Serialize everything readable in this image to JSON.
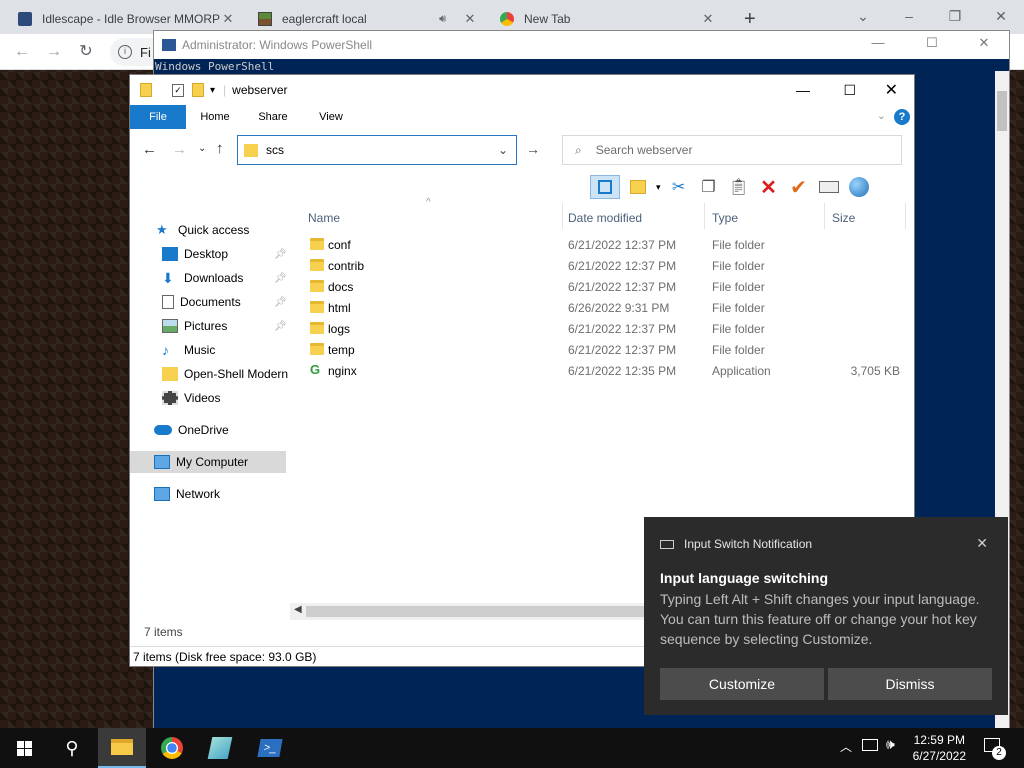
{
  "chrome": {
    "tabs": [
      {
        "title": "Idlescape - Idle Browser MMORP"
      },
      {
        "title": "eaglercraft local",
        "audio": true
      },
      {
        "title": "New Tab"
      }
    ],
    "new_tab": "+",
    "address_partial": "Fi"
  },
  "powershell": {
    "title": "Administrator: Windows PowerShell",
    "first_line": "Windows PowerShell"
  },
  "explorer": {
    "title": "webserver",
    "ribbon_tabs": [
      "File",
      "Home",
      "Share",
      "View"
    ],
    "address": "scs",
    "search_placeholder": "Search webserver",
    "nav": [
      {
        "label": "Quick access"
      },
      {
        "label": "Desktop",
        "pinned": true
      },
      {
        "label": "Downloads",
        "pinned": true
      },
      {
        "label": "Documents",
        "pinned": true
      },
      {
        "label": "Pictures",
        "pinned": true
      },
      {
        "label": "Music"
      },
      {
        "label": "Open-Shell Modern"
      },
      {
        "label": "Videos"
      },
      {
        "label": "OneDrive"
      },
      {
        "label": "My Computer",
        "selected": true
      },
      {
        "label": "Network"
      }
    ],
    "columns": [
      "Name",
      "Date modified",
      "Type",
      "Size"
    ],
    "files": [
      {
        "name": "conf",
        "date": "6/21/2022 12:37 PM",
        "type": "File folder",
        "size": ""
      },
      {
        "name": "contrib",
        "date": "6/21/2022 12:37 PM",
        "type": "File folder",
        "size": ""
      },
      {
        "name": "docs",
        "date": "6/21/2022 12:37 PM",
        "type": "File folder",
        "size": ""
      },
      {
        "name": "html",
        "date": "6/26/2022 9:31 PM",
        "type": "File folder",
        "size": ""
      },
      {
        "name": "logs",
        "date": "6/21/2022 12:37 PM",
        "type": "File folder",
        "size": ""
      },
      {
        "name": "temp",
        "date": "6/21/2022 12:37 PM",
        "type": "File folder",
        "size": ""
      },
      {
        "name": "nginx",
        "date": "6/21/2022 12:35 PM",
        "type": "Application",
        "size": "3,705 KB"
      }
    ],
    "item_count": "7 items",
    "status": "7 items (Disk free space: 93.0 GB)"
  },
  "notification": {
    "app": "Input Switch Notification",
    "heading": "Input language switching",
    "body": "Typing Left Alt + Shift changes your input language. You can turn this feature off or change your hot key sequence by selecting Customize.",
    "customize": "Customize",
    "dismiss": "Dismiss"
  },
  "taskbar": {
    "time": "12:59 PM",
    "date": "6/27/2022",
    "notif_count": "2"
  }
}
